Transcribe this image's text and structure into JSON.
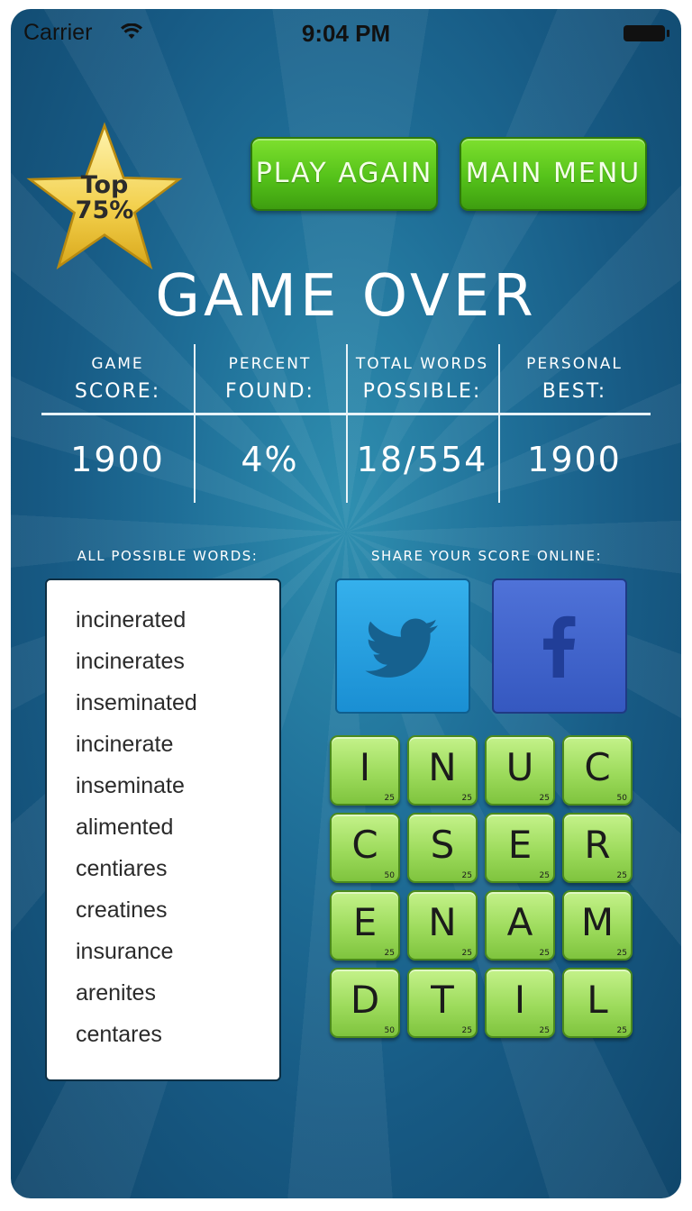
{
  "status": {
    "carrier": "Carrier",
    "time": "9:04 PM"
  },
  "badge": {
    "line1": "Top",
    "line2": "75%"
  },
  "buttons": {
    "play_again": "PLAY AGAIN",
    "main_menu": "MAIN MENU"
  },
  "title": "GAME OVER",
  "stats": [
    {
      "top": "GAME",
      "bottom": "SCORE:",
      "value": "1900"
    },
    {
      "top": "PERCENT",
      "bottom": "FOUND:",
      "value": "4%"
    },
    {
      "top": "TOTAL WORDS",
      "bottom": "POSSIBLE:",
      "value": "18/554"
    },
    {
      "top": "PERSONAL",
      "bottom": "BEST:",
      "value": "1900"
    }
  ],
  "labels": {
    "all_words": "ALL POSSIBLE WORDS:",
    "share": "SHARE YOUR SCORE ONLINE:"
  },
  "words": [
    "incinerated",
    "incinerates",
    "inseminated",
    "incinerate",
    "inseminate",
    "alimented",
    "centiares",
    "creatines",
    "insurance",
    "arenites",
    "centares"
  ],
  "share_icons": [
    "twitter-icon",
    "facebook-icon"
  ],
  "board": [
    [
      {
        "letter": "I",
        "pts": "25"
      },
      {
        "letter": "N",
        "pts": "25"
      },
      {
        "letter": "U",
        "pts": "25"
      },
      {
        "letter": "C",
        "pts": "50"
      }
    ],
    [
      {
        "letter": "C",
        "pts": "50"
      },
      {
        "letter": "S",
        "pts": "25"
      },
      {
        "letter": "E",
        "pts": "25"
      },
      {
        "letter": "R",
        "pts": "25"
      }
    ],
    [
      {
        "letter": "E",
        "pts": "25"
      },
      {
        "letter": "N",
        "pts": "25"
      },
      {
        "letter": "A",
        "pts": "25"
      },
      {
        "letter": "M",
        "pts": "25"
      }
    ],
    [
      {
        "letter": "D",
        "pts": "50"
      },
      {
        "letter": "T",
        "pts": "25"
      },
      {
        "letter": "I",
        "pts": "25"
      },
      {
        "letter": "L",
        "pts": "25"
      }
    ]
  ],
  "colors": {
    "button_green": "#55c21a",
    "tile_green": "#9ddb5c",
    "twitter_blue": "#1a8fd3",
    "facebook_blue": "#3558c0",
    "star_gold": "#f2cf4a"
  }
}
